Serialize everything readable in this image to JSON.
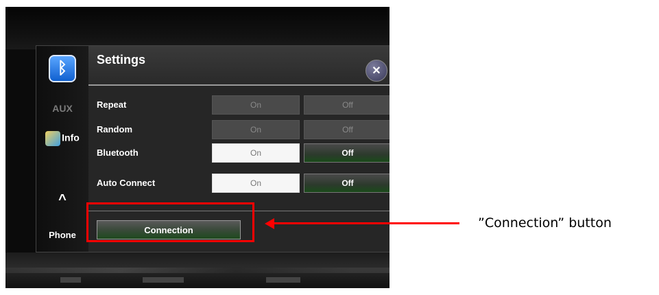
{
  "settings": {
    "title": "Settings",
    "close_label": "✕",
    "rows": [
      {
        "label": "Repeat",
        "on": "On",
        "off": "Off"
      },
      {
        "label": "Random",
        "on": "On",
        "off": "Off"
      },
      {
        "label": "Bluetooth",
        "on": "On",
        "off": "Off"
      },
      {
        "label": "Auto Connect",
        "on": "On",
        "off": "Off"
      }
    ],
    "connection_label": "Connection"
  },
  "rail": {
    "aux_label": "AUX",
    "info_label": "Info",
    "up_label": "^",
    "phone_label": "Phone"
  },
  "annotation": {
    "text": "”Connection” button"
  },
  "colors": {
    "highlight": "#ff0000",
    "bluetooth_icon": "#1060d0"
  }
}
